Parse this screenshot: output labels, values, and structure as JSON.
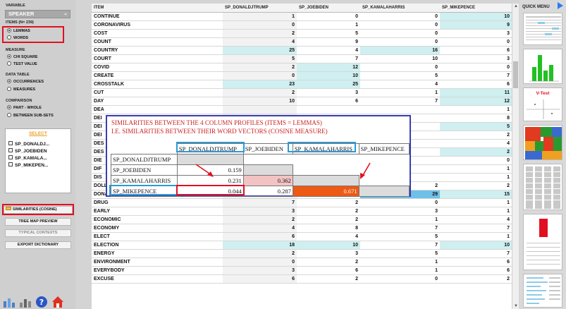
{
  "left": {
    "variable_label": "VARIABLE",
    "variable_value": "SPEAKER",
    "items_label": "ITEMS (N= 239)",
    "items_options": [
      "LEMMAS",
      "WORDS"
    ],
    "measure_label": "MEASURE",
    "measure_options": [
      "CHI SQUARE",
      "TEST VALUE"
    ],
    "datatable_label": "DATA TABLE",
    "datatable_options": [
      "OCCURRENCES",
      "MEASURES"
    ],
    "comparison_label": "COMPARISON",
    "comparison_options": [
      "PART - WHOLE",
      "BETWEEN SUB-SETS"
    ],
    "select_title": "SELECT",
    "select_items": [
      "SP_DONALDJ...",
      "SP_JOEBIDEN",
      "SP_KAMALA...",
      "SP_MIKEPEN..."
    ],
    "buttons": {
      "similarities": "SIMILARITIES (COSINE)",
      "tree_map": "TREE MAP PREVIEW",
      "typical_contexts": "TYPICAL CONTEXTS",
      "export_dictionary": "EXPORT DICTIONARY"
    }
  },
  "table": {
    "headers": [
      "ITEM",
      "SP_DONALDJTRUMP",
      "SP_JOEBIDEN",
      "SP_KAMALAHARRIS",
      "SP_MIKEPENCE"
    ],
    "rows": [
      [
        "CONTINUE",
        "1",
        "0",
        "0",
        "10"
      ],
      [
        "CORONAVIRUS",
        "0",
        "1",
        "0",
        "9"
      ],
      [
        "COST",
        "2",
        "5",
        "0",
        "3"
      ],
      [
        "COUNT",
        "4",
        "9",
        "0",
        "0"
      ],
      [
        "COUNTRY",
        "25",
        "4",
        "16",
        "6"
      ],
      [
        "COURT",
        "5",
        "7",
        "10",
        "3"
      ],
      [
        "COVID",
        "2",
        "12",
        "0",
        "0"
      ],
      [
        "CREATE",
        "0",
        "10",
        "5",
        "7"
      ],
      [
        "CROSSTALK",
        "23",
        "25",
        "4",
        "6"
      ],
      [
        "CUT",
        "2",
        "3",
        "1",
        "11"
      ],
      [
        "DAY",
        "10",
        "6",
        "7",
        "12"
      ],
      [
        "DEA",
        "",
        "",
        "",
        "1"
      ],
      [
        "DEI",
        "",
        "",
        "",
        "8"
      ],
      [
        "DEI",
        "",
        "",
        "",
        "5"
      ],
      [
        "DEI",
        "",
        "",
        "",
        "2"
      ],
      [
        "DES",
        "",
        "",
        "",
        "4"
      ],
      [
        "DES",
        "",
        "",
        "",
        "2"
      ],
      [
        "DIE",
        "",
        "",
        "",
        "0"
      ],
      [
        "DIF",
        "",
        "",
        "",
        "1"
      ],
      [
        "DIS",
        "",
        "",
        "",
        "1"
      ],
      [
        "DOLLAR",
        "9",
        "0",
        "2",
        "2"
      ],
      [
        "DONALD_TRUMP",
        "0",
        "0",
        "29",
        "15"
      ],
      [
        "DRUG",
        "7",
        "2",
        "0",
        "1"
      ],
      [
        "EARLY",
        "3",
        "2",
        "3",
        "1"
      ],
      [
        "ECONOMIC",
        "2",
        "2",
        "1",
        "4"
      ],
      [
        "ECONOMY",
        "4",
        "8",
        "7",
        "7"
      ],
      [
        "ELECT",
        "6",
        "4",
        "5",
        "1"
      ],
      [
        "ELECTION",
        "18",
        "10",
        "7",
        "10"
      ],
      [
        "ENERGY",
        "2",
        "3",
        "5",
        "7"
      ],
      [
        "ENVIRONMENT",
        "0",
        "2",
        "1",
        "6"
      ],
      [
        "EVERYBODY",
        "3",
        "6",
        "1",
        "6"
      ],
      [
        "EXCUSE",
        "6",
        "2",
        "0",
        "2"
      ]
    ]
  },
  "popup": {
    "title_line1": "SIMILARITIES BETWEEN THE 4 COLUMN PROFILES (ITEMS = LEMMAS)",
    "title_line2": "I.E. SIMILARITIES BETWEEN THEIR WORD VECTORS (COSINE MEASURE)",
    "col_headers": [
      "SP_DONALDJTRUMP",
      "SP_JOEBIDEN",
      "SP_KAMALAHARRIS",
      "SP_MIKEPENCE"
    ],
    "rows": [
      {
        "label": "SP_DONALDJTRUMP",
        "values": []
      },
      {
        "label": "SP_JOEBIDEN",
        "values": [
          "0.159"
        ]
      },
      {
        "label": "SP_KAMALAHARRIS",
        "values": [
          "0.231",
          "0.362"
        ]
      },
      {
        "label": "SP_MIKEPENCE",
        "values": [
          "0.044",
          "0.287",
          "0.671"
        ]
      }
    ]
  },
  "right": {
    "title": "QUICK MENU",
    "vtest_label": "V-Test"
  },
  "colors": {
    "highlight_red": "#e01020",
    "popup_border": "#3a3db0",
    "blue_box": "#2a9ad8",
    "select_title": "#e8a020",
    "orange_cell": "#ec5a14",
    "pink_cell": "#f3c3c3",
    "green_bar": "#22c022"
  }
}
